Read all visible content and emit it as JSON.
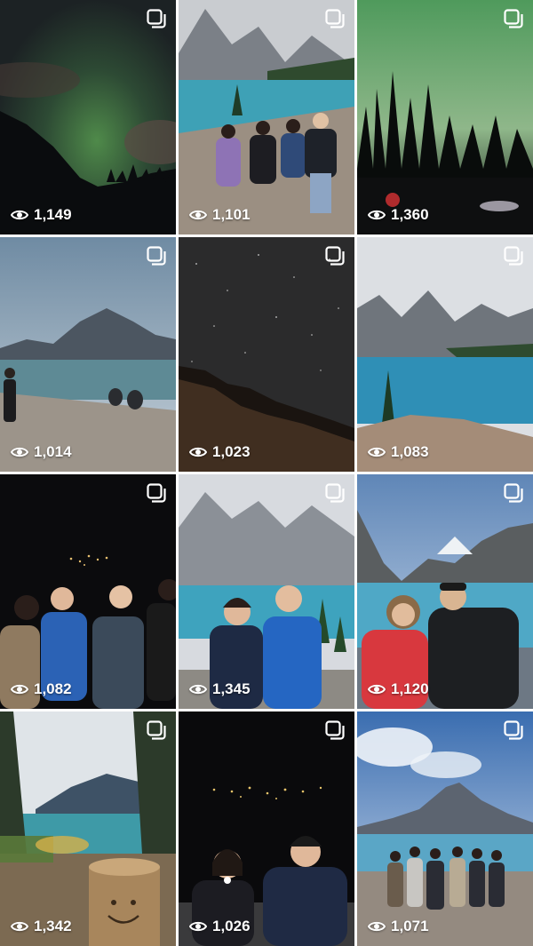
{
  "posts": [
    {
      "views": "1,149",
      "scene": "aurora-mountain"
    },
    {
      "views": "1,101",
      "scene": "lake-group-four"
    },
    {
      "views": "1,360",
      "scene": "aurora-forest"
    },
    {
      "views": "1,014",
      "scene": "bow-lake-shore"
    },
    {
      "views": "1,023",
      "scene": "starry-ridge"
    },
    {
      "views": "1,083",
      "scene": "moraine-lake"
    },
    {
      "views": "1,082",
      "scene": "night-group-four"
    },
    {
      "views": "1,345",
      "scene": "moraine-couple"
    },
    {
      "views": "1,120",
      "scene": "louise-couple"
    },
    {
      "views": "1,342",
      "scene": "lake-smiley-log"
    },
    {
      "views": "1,026",
      "scene": "night-town-couple"
    },
    {
      "views": "1,071",
      "scene": "bow-lake-group"
    }
  ],
  "icons": {
    "views": "eye-icon",
    "carousel": "carousel-icon"
  }
}
